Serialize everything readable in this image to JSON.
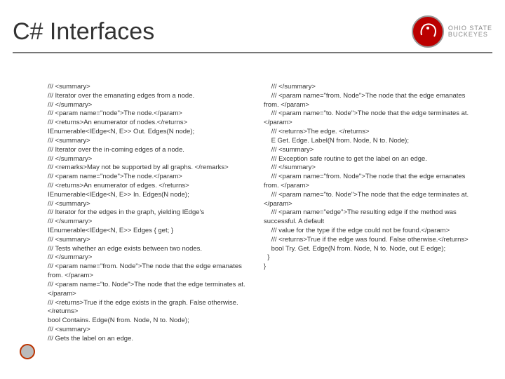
{
  "title": "C# Interfaces",
  "logo": {
    "line1": "OHIO STATE",
    "line2": "BUCKEYES"
  },
  "code_left": "/// <summary>\n/// Iterator over the emanating edges from a node.\n/// </summary>\n/// <param name=\"node\">The node.</param>\n/// <returns>An enumerator of nodes.</returns>\nIEnumerable<IEdge<N, E>> Out. Edges(N node);\n/// <summary>\n/// Iterator over the in-coming edges of a node.\n/// </summary>\n/// <remarks>May not be supported by all graphs. </remarks>\n/// <param name=\"node\">The node.</param>\n/// <returns>An enumerator of edges. </returns>\nIEnumerable<IEdge<N, E>> In. Edges(N node);\n/// <summary>\n/// Iterator for the edges in the graph, yielding IEdge's\n/// </summary>\nIEnumerable<IEdge<N, E>> Edges { get; }\n/// <summary>\n/// Tests whether an edge exists between two nodes.\n/// </summary>\n/// <param name=\"from. Node\">The node that the edge emanates from. </param>\n/// <param name=\"to. Node\">The node that the edge terminates at. </param>\n/// <returns>True if the edge exists in the graph. False otherwise. </returns>\nbool Contains. Edge(N from. Node, N to. Node);\n/// <summary>\n/// Gets the label on an edge.",
  "code_right": "    /// </summary>\n    /// <param name=\"from. Node\">The node that the edge emanates from. </param>\n    /// <param name=\"to. Node\">The node that the edge terminates at. </param>\n    /// <returns>The edge. </returns>\n    E Get. Edge. Label(N from. Node, N to. Node);\n    /// <summary>\n    /// Exception safe routine to get the label on an edge.\n    /// </summary>\n    /// <param name=\"from. Node\">The node that the edge emanates from. </param>\n    /// <param name=\"to. Node\">The node that the edge terminates at. </param>\n    /// <param name=\"edge\">The resulting edge if the method was successful. A default\n    /// value for the type if the edge could not be found.</param>\n    /// <returns>True if the edge was found. False otherwise.</returns>\n    bool Try. Get. Edge(N from. Node, N to. Node, out E edge);\n  }\n}"
}
